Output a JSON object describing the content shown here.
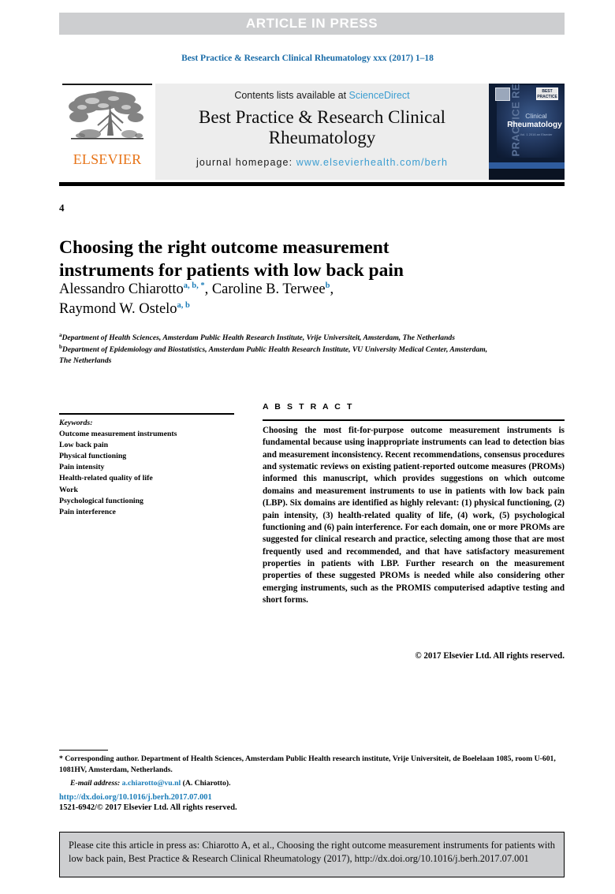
{
  "banner": {
    "text": "ARTICLE IN PRESS"
  },
  "running_head": "Best Practice & Research Clinical Rheumatology xxx (2017) 1–18",
  "masthead": {
    "publisher_name": "ELSEVIER",
    "publisher_logo_alt": "elsevier-tree-logo",
    "contents_prefix": "Contents lists available at ",
    "contents_link": "ScienceDirect",
    "journal_title": "Best Practice & Research Clinical Rheumatology",
    "homepage_label": "journal homepage: ",
    "homepage_url": "www.elsevierhealth.com/berh",
    "cover": {
      "vertical_text": "PRACTICE RESEARCH",
      "line_clinical": "Clinical",
      "line_rheumatology": "Rheumatology",
      "line_sub": "Vol. 1 2016\nan Elsevier",
      "badge_text": "BEST PRACTICE"
    }
  },
  "folio": "4",
  "article": {
    "title": "Choosing the right outcome measurement instruments for patients with low back pain",
    "authors": [
      {
        "name": "Alessandro Chiarotto",
        "marks": "a, b, *"
      },
      {
        "name": "Caroline B. Terwee",
        "marks": "b"
      },
      {
        "name": "Raymond W. Ostelo",
        "marks": "a, b"
      }
    ],
    "affiliations": [
      {
        "marker": "a",
        "text": "Department of Health Sciences, Amsterdam Public Health Research Institute, Vrije Universiteit, Amsterdam, The Netherlands"
      },
      {
        "marker": "b",
        "text": "Department of Epidemiology and Biostatistics, Amsterdam Public Health Research Institute, VU University Medical Center, Amsterdam, The Netherlands"
      }
    ]
  },
  "keywords": {
    "heading": "Keywords:",
    "items": [
      "Outcome measurement instruments",
      "Low back pain",
      "Physical functioning",
      "Pain intensity",
      "Health-related quality of life",
      "Work",
      "Psychological functioning",
      "Pain interference"
    ]
  },
  "abstract": {
    "heading": "A B S T R A C T",
    "body": "Choosing the most fit-for-purpose outcome measurement instruments is fundamental because using inappropriate instruments can lead to detection bias and measurement inconsistency. Recent recommendations, consensus procedures and systematic reviews on existing patient-reported outcome measures (PROMs) informed this manuscript, which provides suggestions on which outcome domains and measurement instruments to use in patients with low back pain (LBP). Six domains are identified as highly relevant: (1) physical functioning, (2) pain intensity, (3) health-related quality of life, (4) work, (5) psychological functioning and (6) pain interference. For each domain, one or more PROMs are suggested for clinical research and practice, selecting among those that are most frequently used and recommended, and that have satisfactory measurement properties in patients with LBP. Further research on the measurement properties of these suggested PROMs is needed while also considering other emerging instruments, such as the PROMIS computerised adaptive testing and short forms.",
    "copyright": "© 2017 Elsevier Ltd. All rights reserved."
  },
  "footnotes": {
    "corresponding": "* Corresponding author. Department of Health Sciences, Amsterdam Public Health research institute, Vrije Universiteit, de Boelelaan 1085, room U-601, 1081HV, Amsterdam, Netherlands.",
    "email_label": "E-mail address:",
    "email": "a.chiarotto@vu.nl",
    "email_suffix": "(A. Chiarotto).",
    "doi": "http://dx.doi.org/10.1016/j.berh.2017.07.001",
    "issn": "1521-6942/© 2017 Elsevier Ltd. All rights reserved."
  },
  "cite_box": {
    "text": "Please cite this article in press as: Chiarotto A, et al., Choosing the right outcome measurement instruments for patients with low back pain, Best Practice & Research Clinical Rheumatology (2017), http://dx.doi.org/10.1016/j.berh.2017.07.001"
  },
  "colors": {
    "banner_bg": "#cdced0",
    "banner_text": "#ffffff",
    "link_blue": "#3b9dd1",
    "running_head_blue": "#1a6ca8",
    "elsevier_orange": "#e77317",
    "masthead_bg": "#ededed",
    "cover_navy": "#0d1b33"
  }
}
